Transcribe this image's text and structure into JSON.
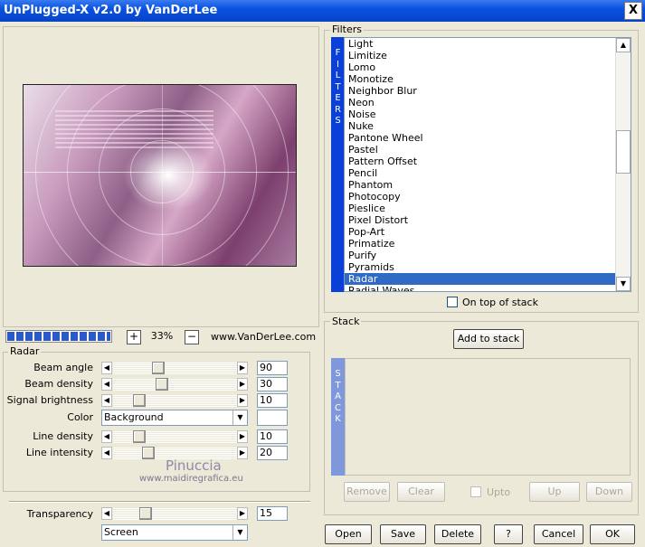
{
  "window": {
    "title": "UnPlugged-X v2.0 by VanDerLee",
    "close_label": "X"
  },
  "preview": {
    "zoom": "33%",
    "plus_label": "+",
    "minus_label": "−",
    "site": "www.VanDerLee.com",
    "progress": 1.0
  },
  "radar": {
    "group_label": "Radar",
    "params": [
      {
        "label": "Beam angle",
        "value": "90",
        "fraction": 0.35
      },
      {
        "label": "Beam density",
        "value": "30",
        "fraction": 0.38
      },
      {
        "label": "Signal brightness",
        "value": "10",
        "fraction": 0.18
      },
      {
        "label": "Line density",
        "value": "10",
        "fraction": 0.18
      },
      {
        "label": "Line intensity",
        "value": "20",
        "fraction": 0.26
      }
    ],
    "color_label": "Color",
    "color_value": "Background",
    "transparency_label": "Transparency",
    "transparency_value": "15",
    "transparency_fraction": 0.23,
    "blend_mode": "Screen"
  },
  "watermark": {
    "name": "Pinuccia",
    "url": "www.maidiregrafica.eu"
  },
  "filters": {
    "group_label": "Filters",
    "tab_label": "FILTERS",
    "items": [
      "Light",
      "Limitize",
      "Lomo",
      "Monotize",
      "Neighbor Blur",
      "Neon",
      "Noise",
      "Nuke",
      "Pantone Wheel",
      "Pastel",
      "Pattern Offset",
      "Pencil",
      "Phantom",
      "Photocopy",
      "Pieslice",
      "Pixel Distort",
      "Pop-Art",
      "Primatize",
      "Purify",
      "Pyramids",
      "Radar",
      "Radial Waves"
    ],
    "selected": "Radar",
    "on_top_label": "On top of stack"
  },
  "stack": {
    "group_label": "Stack",
    "add_label": "Add to stack",
    "tab_label": "STACK",
    "remove_label": "Remove",
    "clear_label": "Clear",
    "upto_label": "Upto",
    "up_label": "Up",
    "down_label": "Down"
  },
  "buttons": {
    "open": "Open",
    "save": "Save",
    "delete": "Delete",
    "help": "?",
    "cancel": "Cancel",
    "ok": "OK"
  }
}
